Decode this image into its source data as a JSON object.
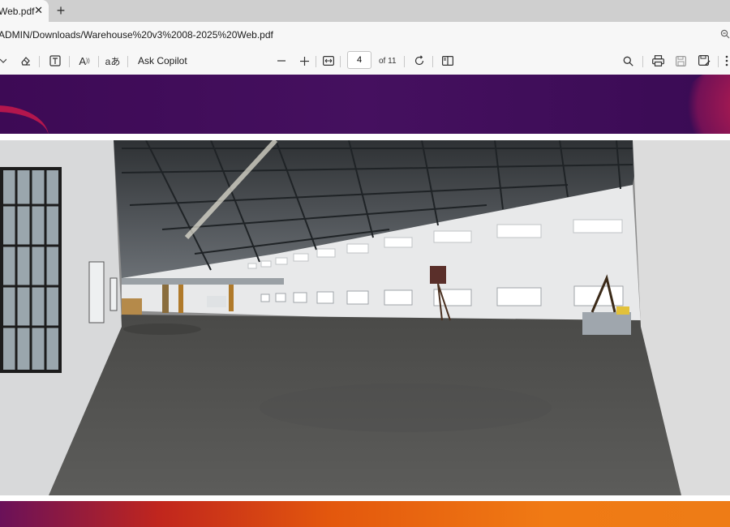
{
  "browser": {
    "tab": {
      "title": "Web.pdf",
      "close": "✕"
    },
    "new_tab": "+",
    "url": "ADMIN/Downloads/Warehouse%20v3%2008-2025%20Web.pdf"
  },
  "toolbar": {
    "ask_copilot": "Ask Copilot",
    "current_page": "4",
    "page_of": "of 11",
    "read_aloud_glyph": "A",
    "translate_glyph": "aあ"
  },
  "document": {
    "banner_colors": {
      "top": "#3d0a55",
      "accent": "#c0174d",
      "bottom": "#ee7c16"
    },
    "photo": "warehouse interior panorama"
  }
}
